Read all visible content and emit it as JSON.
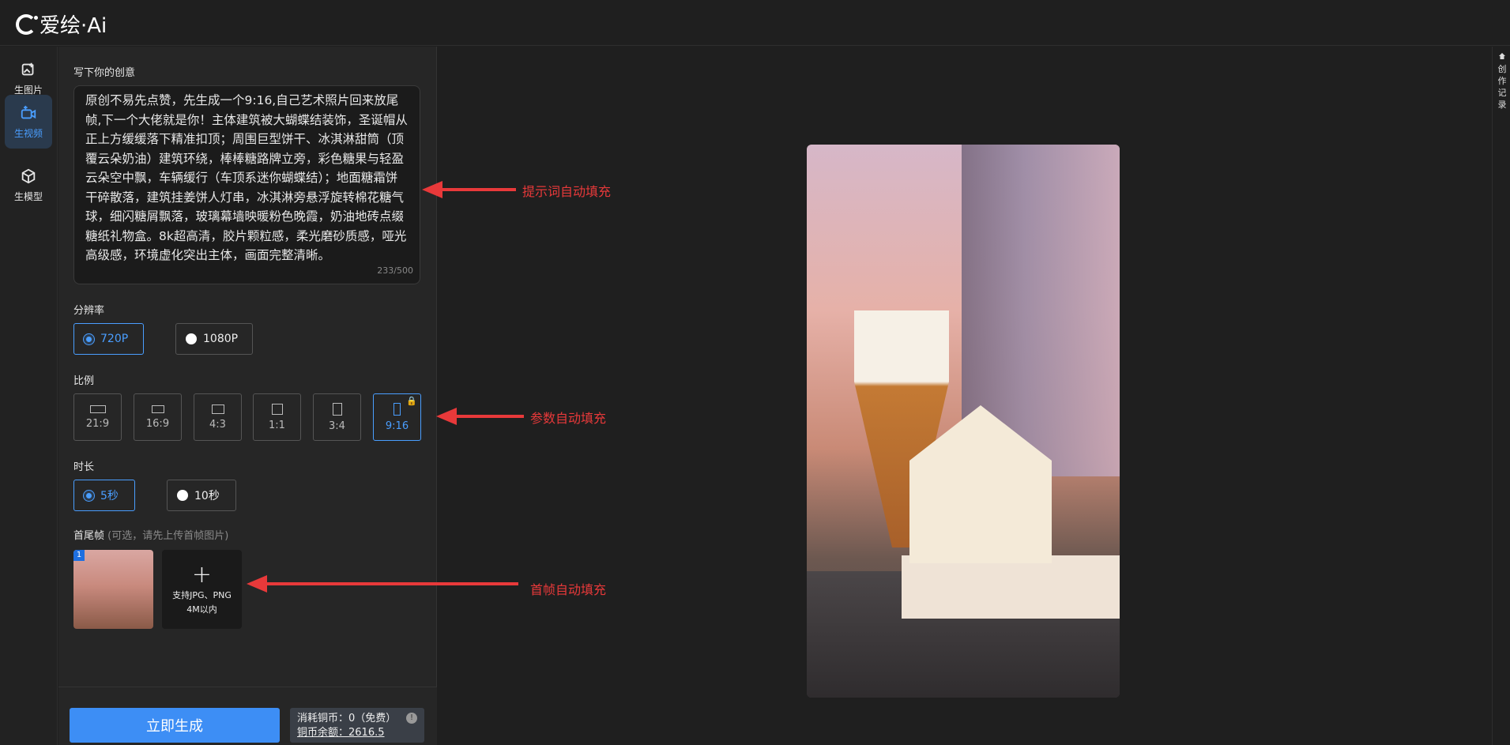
{
  "app": {
    "logo_text": "爱绘·Ai"
  },
  "nav": {
    "items": [
      {
        "label": "生图片",
        "icon": "image-plus-icon"
      },
      {
        "label": "生视频",
        "icon": "video-plus-icon",
        "active": true
      },
      {
        "label": "生模型",
        "icon": "cube-icon"
      }
    ]
  },
  "form": {
    "prompt_label": "写下你的创意",
    "prompt_text": "原创不易先点赞，先生成一个9:16,自己艺术照片回来放尾帧,下一个大佬就是你！主体建筑被大蝴蝶结装饰，圣诞帽从正上方缓缓落下精准扣顶；周围巨型饼干、冰淇淋甜筒（顶覆云朵奶油）建筑环绕，棒棒糖路牌立旁，彩色糖果与轻盈云朵空中飘，车辆缓行（车顶系迷你蝴蝶结）；地面糖霜饼干碎散落，建筑挂姜饼人灯串，冰淇淋旁悬浮旋转棉花糖气球，细闪糖屑飘落，玻璃幕墙映暖粉色晚霞，奶油地砖点缀糖纸礼物盒。8k超高清，胶片颗粒感，柔光磨砂质感，哑光高级感，环境虚化突出主体，画面完整清晰。",
    "prompt_count": "233/500",
    "resolution_label": "分辨率",
    "resolutions": [
      {
        "label": "720P",
        "selected": true
      },
      {
        "label": "1080P",
        "selected": false
      }
    ],
    "ratio_label": "比例",
    "ratios": [
      {
        "label": "21:9"
      },
      {
        "label": "16:9"
      },
      {
        "label": "4:3"
      },
      {
        "label": "1:1"
      },
      {
        "label": "3:4"
      },
      {
        "label": "9:16",
        "selected": true,
        "locked": true
      }
    ],
    "duration_label": "时长",
    "durations": [
      {
        "label": "5秒",
        "selected": true
      },
      {
        "label": "10秒",
        "selected": false
      }
    ],
    "frames_label": "首尾帧",
    "frames_hint": "(可选，请先上传首帧图片)",
    "frame_badge": "1",
    "upload_plus": "+",
    "upload_line1": "支持JPG、PNG",
    "upload_line2": "4M以内"
  },
  "footer": {
    "generate_label": "立即生成",
    "cost_text": "消耗铜币：0（免费）",
    "balance_text": "铜币余额：2616.5",
    "info_mark": "!"
  },
  "annotations": {
    "prompt": "提示词自动填充",
    "params": "参数自动填充",
    "frame": "首帧自动填充"
  },
  "right_bar": {
    "home_icon": "home-icon",
    "history_label": "创作记录"
  },
  "colors": {
    "accent": "#4a9eff",
    "button": "#3d8ef5",
    "annotation": "#e8393a"
  }
}
